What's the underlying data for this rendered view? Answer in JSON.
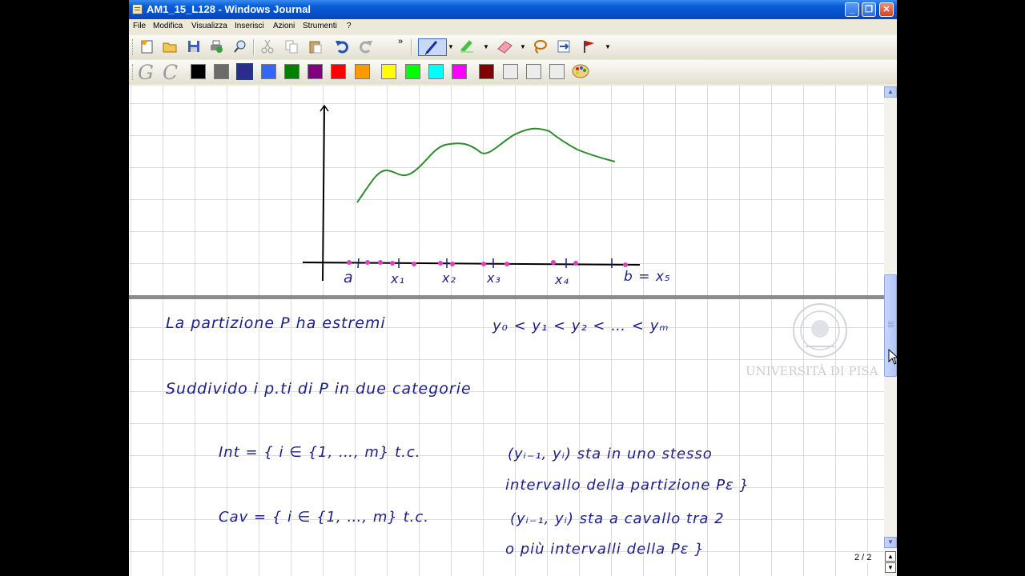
{
  "window": {
    "title": "AM1_15_L128 - Windows Journal"
  },
  "menu": [
    "File",
    "Modifica",
    "Visualizza",
    "Inserisci",
    "Azioni",
    "Strumenti",
    "?"
  ],
  "palette": [
    "#000000",
    "#6b6b6b",
    "#2c2c8c",
    "#3366ff",
    "#008000",
    "#800080",
    "#ff0000",
    "#ff9900",
    "#ffff00",
    "#00ff00",
    "#00ffff",
    "#ff00ff",
    "#800000",
    "#ececec",
    "#ececec",
    "#ececec"
  ],
  "ink": {
    "axis_labels": [
      "a",
      "x₁",
      "x₂",
      "x₃",
      "x₄",
      "b = x₅"
    ],
    "line1": "La partizione P ha estremi",
    "line1_formula": "y₀ < y₁ < y₂ < … < yₘ",
    "line2": "Suddivido i p.ti di P in due categorie",
    "int_lhs": "Int = { i ∈ {1, …, m} t.c.",
    "int_rhs1": "(yᵢ₋₁, yᵢ) sta in uno stesso",
    "int_rhs2": "intervallo della partizione Pε }",
    "cav_lhs": "Cav = { i ∈ {1, …, m} t.c.",
    "cav_rhs1": "(yᵢ₋₁, yᵢ) sta a cavallo tra 2",
    "cav_rhs2": "o più intervalli della Pε }"
  },
  "logo": {
    "text": "UNIVERSITÀ DI PISA"
  },
  "page_indicator": "2 / 2"
}
